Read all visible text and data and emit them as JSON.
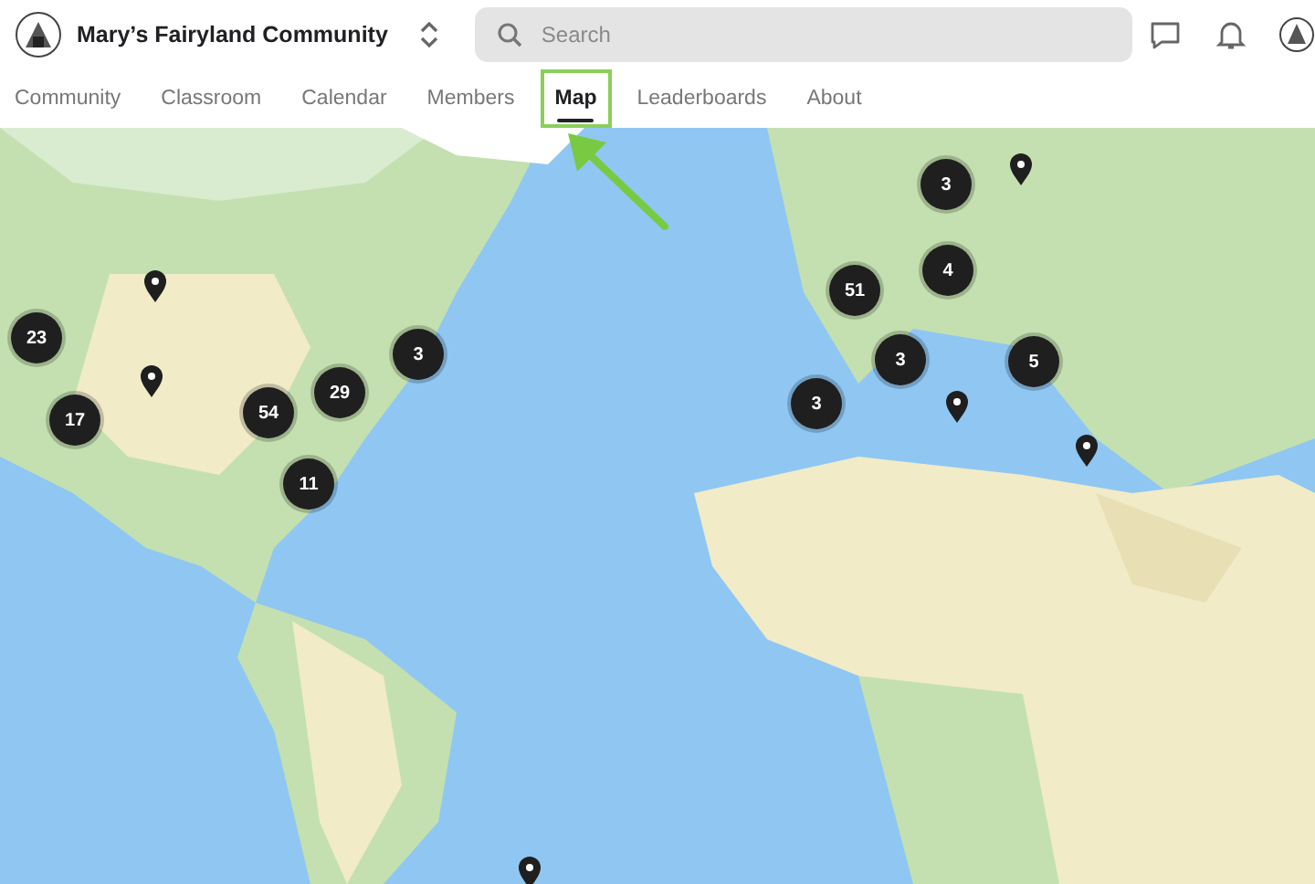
{
  "header": {
    "title": "Mary’s Fairyland Community",
    "search": {
      "placeholder": "Search"
    }
  },
  "tabs": [
    {
      "label": "Community",
      "selected": false,
      "highlighted": false
    },
    {
      "label": "Classroom",
      "selected": false,
      "highlighted": false
    },
    {
      "label": "Calendar",
      "selected": false,
      "highlighted": false
    },
    {
      "label": "Members",
      "selected": false,
      "highlighted": false
    },
    {
      "label": "Map",
      "selected": true,
      "highlighted": true
    },
    {
      "label": "Leaderboards",
      "selected": false,
      "highlighted": false
    },
    {
      "label": "About",
      "selected": false,
      "highlighted": false
    }
  ],
  "map": {
    "markers": [
      {
        "kind": "pin"
      },
      {
        "kind": "cluster",
        "count": "23"
      },
      {
        "kind": "pin"
      },
      {
        "kind": "cluster",
        "count": "17"
      },
      {
        "kind": "cluster",
        "count": "54"
      },
      {
        "kind": "cluster",
        "count": "29"
      },
      {
        "kind": "cluster",
        "count": "3"
      },
      {
        "kind": "cluster",
        "count": "11"
      },
      {
        "kind": "cluster",
        "count": "3"
      },
      {
        "kind": "pin"
      },
      {
        "kind": "cluster",
        "count": "51"
      },
      {
        "kind": "cluster",
        "count": "4"
      },
      {
        "kind": "cluster",
        "count": "3"
      },
      {
        "kind": "cluster",
        "count": "5"
      },
      {
        "kind": "cluster",
        "count": "3"
      },
      {
        "kind": "pin"
      },
      {
        "kind": "pin"
      },
      {
        "kind": "pin"
      }
    ]
  }
}
